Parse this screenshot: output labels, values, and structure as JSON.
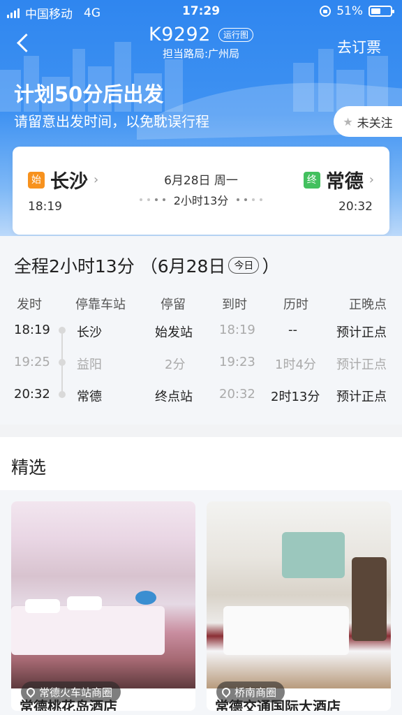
{
  "status": {
    "carrier": "中国移动",
    "network": "4G",
    "time": "17:29",
    "battery": "51%",
    "battery_level": 0.51
  },
  "nav": {
    "train_no": "K9292",
    "diagram_badge": "运行图",
    "bureau": "担当路局:广州局",
    "book_label": "去订票"
  },
  "countdown": {
    "title": "计划50分后出发",
    "subtitle": "请留意出发时间，以免耽误行程",
    "follow_label": "未关注"
  },
  "route": {
    "from": {
      "tag": "始",
      "name": "长沙",
      "time": "18:19"
    },
    "to": {
      "tag": "终",
      "name": "常德",
      "time": "20:32"
    },
    "date": "6月28日 周一",
    "duration": "2小时13分"
  },
  "schedule": {
    "title_prefix": "全程2小时13分",
    "title_date_open": "（6月28日",
    "today_label": "今日",
    "title_close": "）",
    "headers": [
      "发时",
      "停靠车站",
      "停留",
      "到时",
      "历时",
      "正晚点"
    ],
    "rows": [
      {
        "depart": "18:19",
        "station": "长沙",
        "stop": "始发站",
        "arrive": "18:19",
        "elapsed": "--",
        "status": "预计正点"
      },
      {
        "depart": "19:25",
        "station": "益阳",
        "stop": "2分",
        "arrive": "19:23",
        "elapsed": "1时4分",
        "status": "预计正点"
      },
      {
        "depart": "20:32",
        "station": "常德",
        "stop": "终点站",
        "arrive": "20:32",
        "elapsed": "2时13分",
        "status": "预计正点"
      }
    ]
  },
  "featured": {
    "title": "精选",
    "hotels": [
      {
        "area": "常德火车站商圈",
        "name": "常德桃花岛酒店"
      },
      {
        "area": "桥南商圈",
        "name": "常德交通国际大酒店"
      }
    ]
  }
}
